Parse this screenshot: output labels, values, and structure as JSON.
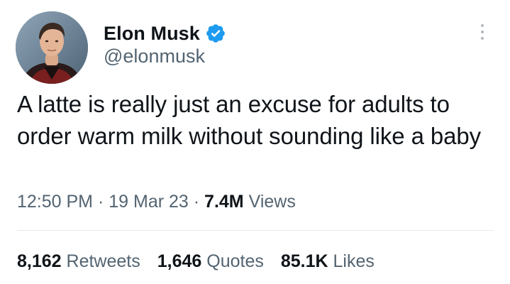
{
  "author": {
    "display_name": "Elon Musk",
    "handle": "@elonmusk",
    "verified_icon": "verified-badge-icon",
    "verified_color": "#1d9bf0"
  },
  "tweet": {
    "text": "A latte is really just an excuse for adults to order warm milk without sounding like a baby",
    "time": "12:50 PM",
    "date": "19 Mar 23",
    "views_count": "7.4M",
    "views_label": "Views",
    "separator": "·"
  },
  "stats": {
    "retweets_count": "8,162",
    "retweets_label": "Retweets",
    "quotes_count": "1,646",
    "quotes_label": "Quotes",
    "likes_count": "85.1K",
    "likes_label": "Likes"
  },
  "more_icon": "more-vertical-icon"
}
